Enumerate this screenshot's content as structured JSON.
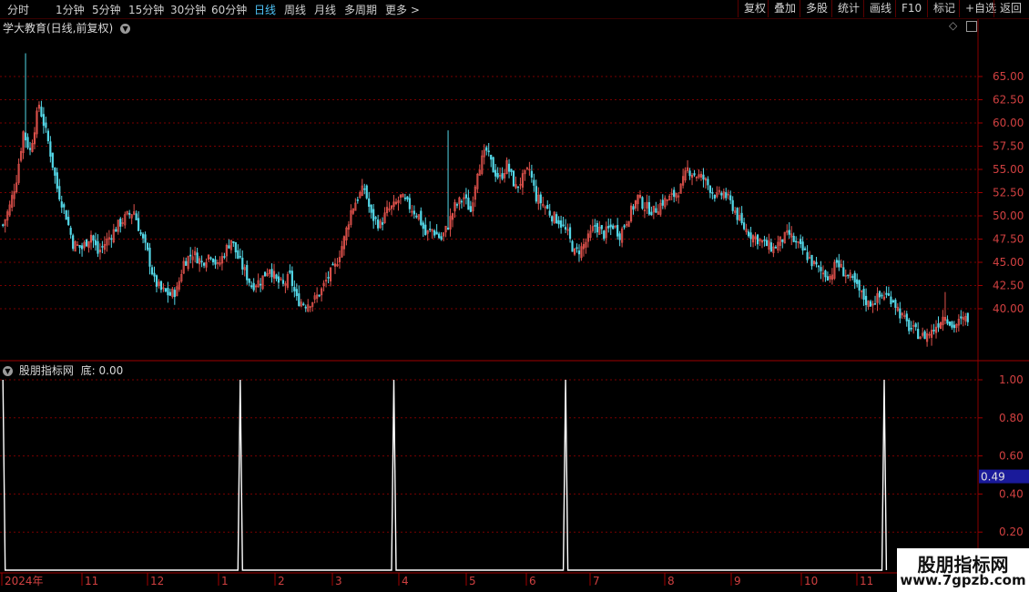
{
  "toolbar": {
    "periods": [
      "分时",
      "1分钟",
      "5分钟",
      "15分钟",
      "30分钟",
      "60分钟",
      "日线",
      "周线",
      "月线",
      "多周期",
      "更多 >"
    ],
    "active": 6,
    "buttons": [
      "复权",
      "叠加",
      "多股",
      "统计",
      "画线",
      "F10",
      "标记",
      "+自选",
      "返回"
    ]
  },
  "main_panel": {
    "title": "学大教育(日线,前复权)"
  },
  "indicator_panel": {
    "title": "股朋指标网",
    "label": "底:",
    "value": "0.00",
    "cursor_value": "0.49"
  },
  "watermark": {
    "line1": "股朋指标网",
    "line2": "www.7gpzb.com"
  },
  "colors": {
    "background": "#000000",
    "up": "#e0524c",
    "down": "#54d8e8",
    "grid": "#7a0000",
    "axis_text": "#d04040",
    "indicator_line": "#ffffff",
    "cursor_box": "#1a1a9a"
  },
  "chart_data": [
    {
      "type": "candlestick",
      "title": "学大教育(日线,前复权)",
      "ylim": [
        36.5,
        68.5
      ],
      "yticks": [
        "40.00",
        "42.50",
        "45.00",
        "47.50",
        "50.00",
        "52.50",
        "55.00",
        "57.50",
        "60.00",
        "62.50",
        "65.00"
      ],
      "grid": true,
      "series": [
        {
          "name": "close",
          "points": [
            [
              0,
              49
            ],
            [
              3,
              51
            ],
            [
              6,
              54
            ],
            [
              9,
              59
            ],
            [
              12,
              57
            ],
            [
              16,
              62
            ],
            [
              20,
              58
            ],
            [
              24,
              53
            ],
            [
              28,
              50
            ],
            [
              31,
              47
            ],
            [
              35,
              46.5
            ],
            [
              39,
              48
            ],
            [
              42,
              46
            ],
            [
              45,
              47
            ],
            [
              48,
              48
            ],
            [
              51,
              49
            ],
            [
              55,
              50
            ],
            [
              58,
              50.5
            ],
            [
              61,
              48
            ],
            [
              64,
              46
            ],
            [
              67,
              43
            ],
            [
              70,
              42
            ],
            [
              74,
              41.5
            ],
            [
              77,
              42
            ],
            [
              80,
              45
            ],
            [
              84,
              46
            ],
            [
              88,
              45
            ],
            [
              92,
              46
            ],
            [
              95,
              44.5
            ],
            [
              98,
              46
            ],
            [
              101,
              47.5
            ],
            [
              104,
              45.5
            ],
            [
              107,
              44
            ],
            [
              110,
              42.5
            ],
            [
              114,
              43
            ],
            [
              118,
              44.5
            ],
            [
              121,
              43
            ],
            [
              124,
              42.5
            ],
            [
              127,
              43.5
            ],
            [
              130,
              41
            ],
            [
              134,
              40.5
            ],
            [
              138,
              41
            ],
            [
              141,
              42
            ],
            [
              144,
              43.5
            ],
            [
              147,
              44.5
            ],
            [
              151,
              47.5
            ],
            [
              154,
              50.5
            ],
            [
              157,
              52
            ],
            [
              160,
              53
            ],
            [
              163,
              50
            ],
            [
              167,
              49
            ],
            [
              170,
              50.5
            ],
            [
              173,
              51
            ],
            [
              176,
              52
            ],
            [
              180,
              51
            ],
            [
              184,
              50
            ],
            [
              187,
              48
            ],
            [
              190,
              48.5
            ],
            [
              194,
              47.5
            ],
            [
              197,
              49
            ],
            [
              200,
              51
            ],
            [
              204,
              52
            ],
            [
              207,
              50.5
            ],
            [
              210,
              55
            ],
            [
              214,
              57
            ],
            [
              217,
              55
            ],
            [
              220,
              54
            ],
            [
              223,
              55.5
            ],
            [
              227,
              53
            ],
            [
              230,
              54
            ],
            [
              233,
              55
            ],
            [
              236,
              52
            ],
            [
              240,
              51
            ],
            [
              243,
              50
            ],
            [
              246,
              49.5
            ],
            [
              250,
              48
            ],
            [
              253,
              46
            ],
            [
              256,
              46.5
            ],
            [
              259,
              47.5
            ],
            [
              262,
              49
            ],
            [
              266,
              48
            ],
            [
              270,
              49
            ],
            [
              273,
              48
            ],
            [
              277,
              50
            ],
            [
              281,
              52
            ],
            [
              284,
              51
            ],
            [
              288,
              50.5
            ],
            [
              292,
              51.5
            ],
            [
              296,
              52
            ],
            [
              300,
              53
            ],
            [
              303,
              55
            ],
            [
              306,
              54.5
            ],
            [
              310,
              54
            ],
            [
              313,
              53
            ],
            [
              316,
              52
            ],
            [
              319,
              52.5
            ],
            [
              323,
              51
            ],
            [
              327,
              49
            ],
            [
              331,
              48
            ],
            [
              334,
              47.5
            ],
            [
              337,
              47
            ],
            [
              341,
              46.5
            ],
            [
              345,
              47.5
            ],
            [
              348,
              48
            ],
            [
              351,
              47
            ],
            [
              355,
              46
            ],
            [
              358,
              45
            ],
            [
              362,
              44
            ],
            [
              366,
              43.5
            ],
            [
              369,
              45
            ],
            [
              372,
              44
            ],
            [
              376,
              43
            ],
            [
              380,
              41.5
            ],
            [
              383,
              40.5
            ],
            [
              386,
              41
            ],
            [
              390,
              41.5
            ],
            [
              394,
              41
            ],
            [
              397,
              39.5
            ],
            [
              401,
              38
            ],
            [
              404,
              37.5
            ],
            [
              407,
              37
            ],
            [
              411,
              37.5
            ],
            [
              414,
              38.5
            ],
            [
              417,
              39.5
            ],
            [
              420,
              38
            ],
            [
              423,
              38.5
            ],
            [
              427,
              39
            ]
          ],
          "x_note": "trading day index"
        }
      ]
    },
    {
      "type": "line",
      "title": "股朋指标网",
      "ylim": [
        0,
        1.05
      ],
      "yticks": [
        "0.20",
        "0.40",
        "0.60",
        "0.80",
        "1.00"
      ],
      "series": [
        {
          "name": "底",
          "points": [
            [
              0,
              1
            ],
            [
              1,
              0
            ],
            [
              104,
              0
            ],
            [
              105,
              1
            ],
            [
              106,
              0
            ],
            [
              172,
              0
            ],
            [
              173,
              1
            ],
            [
              174,
              0
            ],
            [
              248,
              0
            ],
            [
              249,
              1
            ],
            [
              250,
              0
            ],
            [
              389,
              0
            ],
            [
              390,
              1
            ],
            [
              391,
              0
            ]
          ]
        }
      ]
    }
  ],
  "x_axis": {
    "labels": [
      "2024年",
      "11",
      "12",
      "1",
      "2",
      "3",
      "4",
      "5",
      "6",
      "7",
      "8",
      "9",
      "10",
      "11"
    ]
  }
}
